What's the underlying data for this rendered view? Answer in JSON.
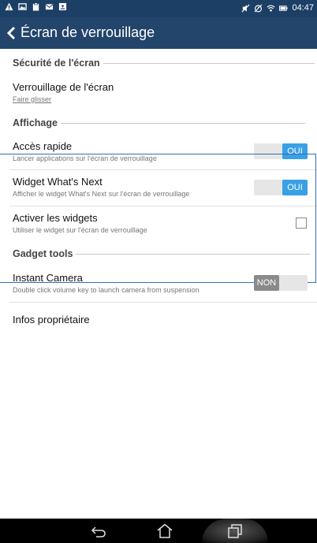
{
  "status_bar": {
    "left_icons": [
      "warning-icon",
      "image-icon",
      "clipboard-icon",
      "mail-icon",
      "download-icon"
    ],
    "right_icons": [
      "mute-icon",
      "alarm-icon",
      "wifi-icon",
      "battery-icon"
    ],
    "time": "04:47"
  },
  "app_bar": {
    "title": "Écran de verrouillage"
  },
  "sections": {
    "security": "Sécurité de l'écran",
    "display": "Affichage",
    "gadget": "Gadget tools"
  },
  "items": {
    "screen_lock": {
      "title": "Verrouillage de l'écran",
      "subtitle": "Faire glisser"
    },
    "quick_access": {
      "title": "Accès rapide",
      "subtitle": "Lancer applications sur l'écran de verrouillage",
      "toggle": "OUI"
    },
    "whats_next": {
      "title": "Widget What's Next",
      "subtitle": "Afficher le widget What's Next sur l'écran de verrouillage",
      "toggle": "OUI"
    },
    "widgets": {
      "title": "Activer les widgets",
      "subtitle": "Utiliser le widget sur l'écran de verrouillage",
      "checked": false
    },
    "instant_camera": {
      "title": "Instant Camera",
      "subtitle": "Double click volume key to launch camera from suspension",
      "toggle": "NON"
    },
    "owner_info": {
      "title": "Infos propriétaire"
    }
  },
  "colors": {
    "status_bar": "#1c3f66",
    "app_bar": "#23456b",
    "toggle_on": "#3aa0e6",
    "toggle_off": "#8a8a8a",
    "highlight": "#2f6fb3"
  },
  "nav": [
    "back-icon",
    "home-icon",
    "recents-icon"
  ]
}
